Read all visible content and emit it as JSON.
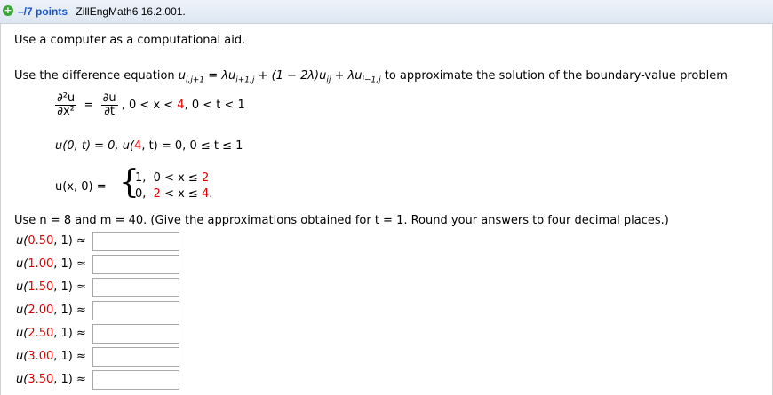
{
  "header": {
    "points": "–/7 points",
    "assignment": "ZillEngMath6 16.2.001."
  },
  "intro": "Use a computer as a computational aid.",
  "problem": {
    "lead": "Use the difference equation",
    "equation": "u_{i,j+1} = λu_{i+1,j} + (1 − 2λ)u_{ij} + λu_{i−1,j}",
    "tail": "to approximate the solution of the boundary-value problem"
  },
  "pde": {
    "lhs_num": "∂²u",
    "lhs_den": "∂x²",
    "rhs_num": "∂u",
    "rhs_den": "∂t",
    "domain_prefix": ",   0 < x < ",
    "x_upper": "4",
    "domain_suffix": ", 0 < t < 1"
  },
  "bc": {
    "left": "u(0, t) = 0,",
    "right_prefix": "u(",
    "right_val": "4",
    "right_suffix": ", t) = 0, 0 ≤ t ≤ 1"
  },
  "ic": {
    "lhs": "u(x, 0) =",
    "case1_val": "1,",
    "case1_cond_prefix": "0 < x ≤ ",
    "case1_cond_red": "2",
    "case2_val": "0,",
    "case2_cond_red": "2",
    "case2_cond_mid": " < x ≤ ",
    "case2_cond_end": "4",
    "case2_dot": "."
  },
  "instructions": "Use  n = 8  and  m = 40.  (Give the approximations obtained for  t = 1.  Round your answers to four decimal places.)",
  "answers": [
    {
      "x": "0.50",
      "t": ", 1) ≈",
      "value": ""
    },
    {
      "x": "1.00",
      "t": ", 1) ≈",
      "value": ""
    },
    {
      "x": "1.50",
      "t": ", 1) ≈",
      "value": ""
    },
    {
      "x": "2.00",
      "t": ", 1) ≈",
      "value": ""
    },
    {
      "x": "2.50",
      "t": ", 1) ≈",
      "value": ""
    },
    {
      "x": "3.00",
      "t": ", 1) ≈",
      "value": ""
    },
    {
      "x": "3.50",
      "t": ", 1) ≈",
      "value": ""
    }
  ],
  "answer_prefix": "u(",
  "colors": {
    "accent": "#1a56c8",
    "highlight": "#dd0000",
    "plus": "#3aa53a"
  }
}
